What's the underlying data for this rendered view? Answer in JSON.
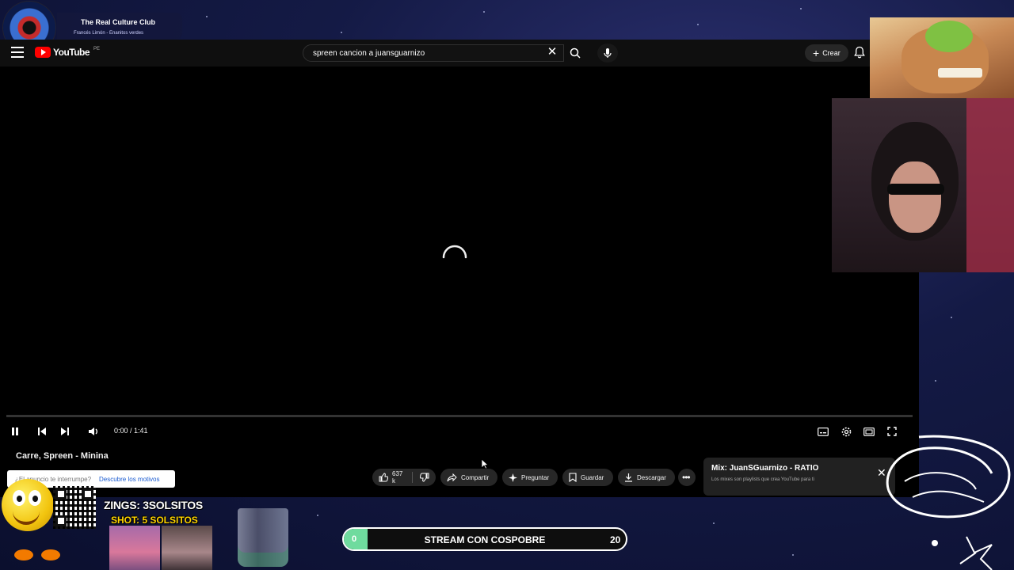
{
  "now_playing": {
    "title": "The Real Culture Club",
    "artist": "Francés Limón - Enanitos verdes"
  },
  "youtube": {
    "logo_text": "YouTube",
    "country_code": "PE",
    "search": {
      "value": "spreen cancion a juansguarnizo"
    },
    "create_label": "Crear",
    "player": {
      "time": "0:00 / 1:41",
      "state": "buffering"
    },
    "video_title": "Carre, Spreen - Minina",
    "feedback": {
      "question": "¿El anuncio te interrumpe?",
      "link": "Descubre los motivos"
    },
    "actions": {
      "likes": "637 k",
      "share": "Compartir",
      "ask": "Preguntar",
      "save": "Guardar",
      "download": "Descargar"
    },
    "mix": {
      "title": "Mix: JuanSGuarnizo - RATIO",
      "subtitle": "Los mixes son playlists que crea YouTube para ti"
    }
  },
  "overlay": {
    "zings": "ZINGS: 3SOLSITOS",
    "shot": "SHOT: 5 SOLSITOS",
    "goal": {
      "label": "STREAM CON COSPOBRE",
      "current": "0",
      "target": "20",
      "progress": 0.0
    }
  },
  "colors": {
    "youtube_red": "#ff0000",
    "goal_fill": "#6fdb9e",
    "accent_yellow": "#ffd400"
  }
}
